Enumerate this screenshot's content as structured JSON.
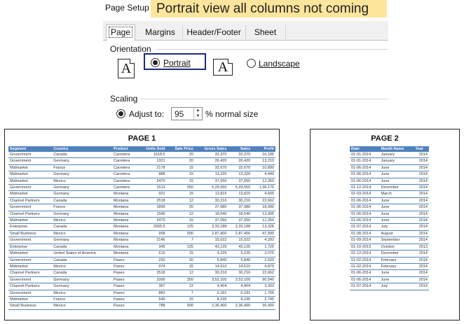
{
  "dialog": {
    "title": "Page Setup",
    "banner": "Portrait view all columns not coming",
    "tabs": [
      "Page",
      "Margins",
      "Header/Footer",
      "Sheet"
    ],
    "orientation": {
      "label": "Orientation",
      "portrait_label": "Portrait",
      "landscape_label": "Landscape",
      "icon_glyph": "A",
      "selected": "Portrait"
    },
    "scaling": {
      "label": "Scaling",
      "adjust_label": "Adjust to:",
      "adjust_value": "95",
      "suffix": "% normal size"
    }
  },
  "page1": {
    "title": "PAGE 1",
    "headers": [
      "Segment",
      "Country",
      "Product",
      "Units Sold",
      "Sale Price",
      "Gross Sales",
      "Sales",
      "Profit"
    ],
    "rows": [
      [
        "Government",
        "Canada",
        "Carretera",
        "1618.5",
        "20",
        "32,370",
        "32,370",
        "16,185"
      ],
      [
        "Government",
        "Germany",
        "Carretera",
        "1321",
        "20",
        "26,420",
        "26,420",
        "13,210"
      ],
      [
        "Midmarket",
        "France",
        "Carretera",
        "2178",
        "15",
        "32,670",
        "32,670",
        "10,890"
      ],
      [
        "Midmarket",
        "Germany",
        "Carretera",
        "888",
        "15",
        "13,320",
        "13,320",
        "4,440"
      ],
      [
        "Midmarket",
        "Mexico",
        "Carretera",
        "2470",
        "15",
        "37,050",
        "37,050",
        "12,350"
      ],
      [
        "Government",
        "Germany",
        "Carretera",
        "1513",
        "350",
        "5,29,550",
        "5,29,550",
        "1,36,170"
      ],
      [
        "Midmarket",
        "Germany",
        "Montana",
        "921",
        "15",
        "13,815",
        "13,815",
        "4,605"
      ],
      [
        "Channel Partners",
        "Canada",
        "Montana",
        "2518",
        "12",
        "30,216",
        "30,216",
        "22,662"
      ],
      [
        "Government",
        "France",
        "Montana",
        "1899",
        "20",
        "37,980",
        "37,980",
        "18,990"
      ],
      [
        "Channel Partners",
        "Germany",
        "Montana",
        "1545",
        "12",
        "18,540",
        "18,540",
        "13,905"
      ],
      [
        "Midmarket",
        "Mexico",
        "Montana",
        "2470",
        "15",
        "37,050",
        "37,050",
        "12,350"
      ],
      [
        "Enterprise",
        "Canada",
        "Montana",
        "2665.5",
        "125",
        "3,33,188",
        "3,33,188",
        "13,328"
      ],
      [
        "Small Business",
        "Mexico",
        "Montana",
        "958",
        "300",
        "2,87,400",
        "2,87,400",
        "47,900"
      ],
      [
        "Government",
        "Germany",
        "Montana",
        "2146",
        "7",
        "15,022",
        "15,022",
        "4,292"
      ],
      [
        "Enterprise",
        "Canada",
        "Montana",
        "345",
        "125",
        "43,125",
        "43,125",
        "1,725"
      ],
      [
        "Midmarket",
        "United States of America",
        "Montana",
        "615",
        "15",
        "9,225",
        "9,225",
        "3,075"
      ],
      [
        "Government",
        "Canada",
        "Paseo",
        "292",
        "20",
        "5,840",
        "5,840",
        "2,920"
      ],
      [
        "Midmarket",
        "Mexico",
        "Paseo",
        "974",
        "15",
        "14,610",
        "14,610",
        "4,870"
      ],
      [
        "Channel Partners",
        "Canada",
        "Paseo",
        "2518",
        "12",
        "30,216",
        "30,216",
        "22,662"
      ],
      [
        "Government",
        "Germany",
        "Paseo",
        "1006",
        "350",
        "3,52,100",
        "3,52,100",
        "90,540"
      ],
      [
        "Channel Partners",
        "Germany",
        "Paseo",
        "367",
        "12",
        "4,404",
        "4,404",
        "3,303"
      ],
      [
        "Government",
        "Mexico",
        "Paseo",
        "883",
        "7",
        "6,181",
        "6,181",
        "1,766"
      ],
      [
        "Midmarket",
        "France",
        "Paseo",
        "549",
        "15",
        "8,235",
        "8,235",
        "2,745"
      ],
      [
        "Small Business",
        "Mexico",
        "Paseo",
        "788",
        "300",
        "2,36,400",
        "2,36,400",
        "39,400"
      ]
    ]
  },
  "page2": {
    "title": "PAGE 2",
    "headers": [
      "Date",
      "Month Name",
      "Year"
    ],
    "rows": [
      [
        "01-01-2014",
        "January",
        "2014"
      ],
      [
        "01-01-2014",
        "January",
        "2014"
      ],
      [
        "01-06-2014",
        "June",
        "2014"
      ],
      [
        "01-06-2014",
        "June",
        "2014"
      ],
      [
        "01-06-2014",
        "June",
        "2014"
      ],
      [
        "01-12-2014",
        "December",
        "2014"
      ],
      [
        "01-03-2014",
        "March",
        "2014"
      ],
      [
        "01-06-2014",
        "June",
        "2014"
      ],
      [
        "01-06-2014",
        "June",
        "2014"
      ],
      [
        "01-06-2014",
        "June",
        "2014"
      ],
      [
        "01-06-2014",
        "June",
        "2014"
      ],
      [
        "01-07-2014",
        "July",
        "2014"
      ],
      [
        "01-08-2014",
        "August",
        "2014"
      ],
      [
        "01-09-2014",
        "September",
        "2014"
      ],
      [
        "01-10-2013",
        "October",
        "2013"
      ],
      [
        "01-12-2014",
        "December",
        "2014"
      ],
      [
        "01-02-2014",
        "February",
        "2014"
      ],
      [
        "01-02-2014",
        "February",
        "2014"
      ],
      [
        "01-06-2014",
        "June",
        "2014"
      ],
      [
        "01-06-2014",
        "June",
        "2014"
      ],
      [
        "01-07-2014",
        "July",
        "2014"
      ]
    ]
  },
  "colors": {
    "accent": "#4f81bd",
    "banner": "#fde59c",
    "highlight_border": "#1f2a7a"
  }
}
